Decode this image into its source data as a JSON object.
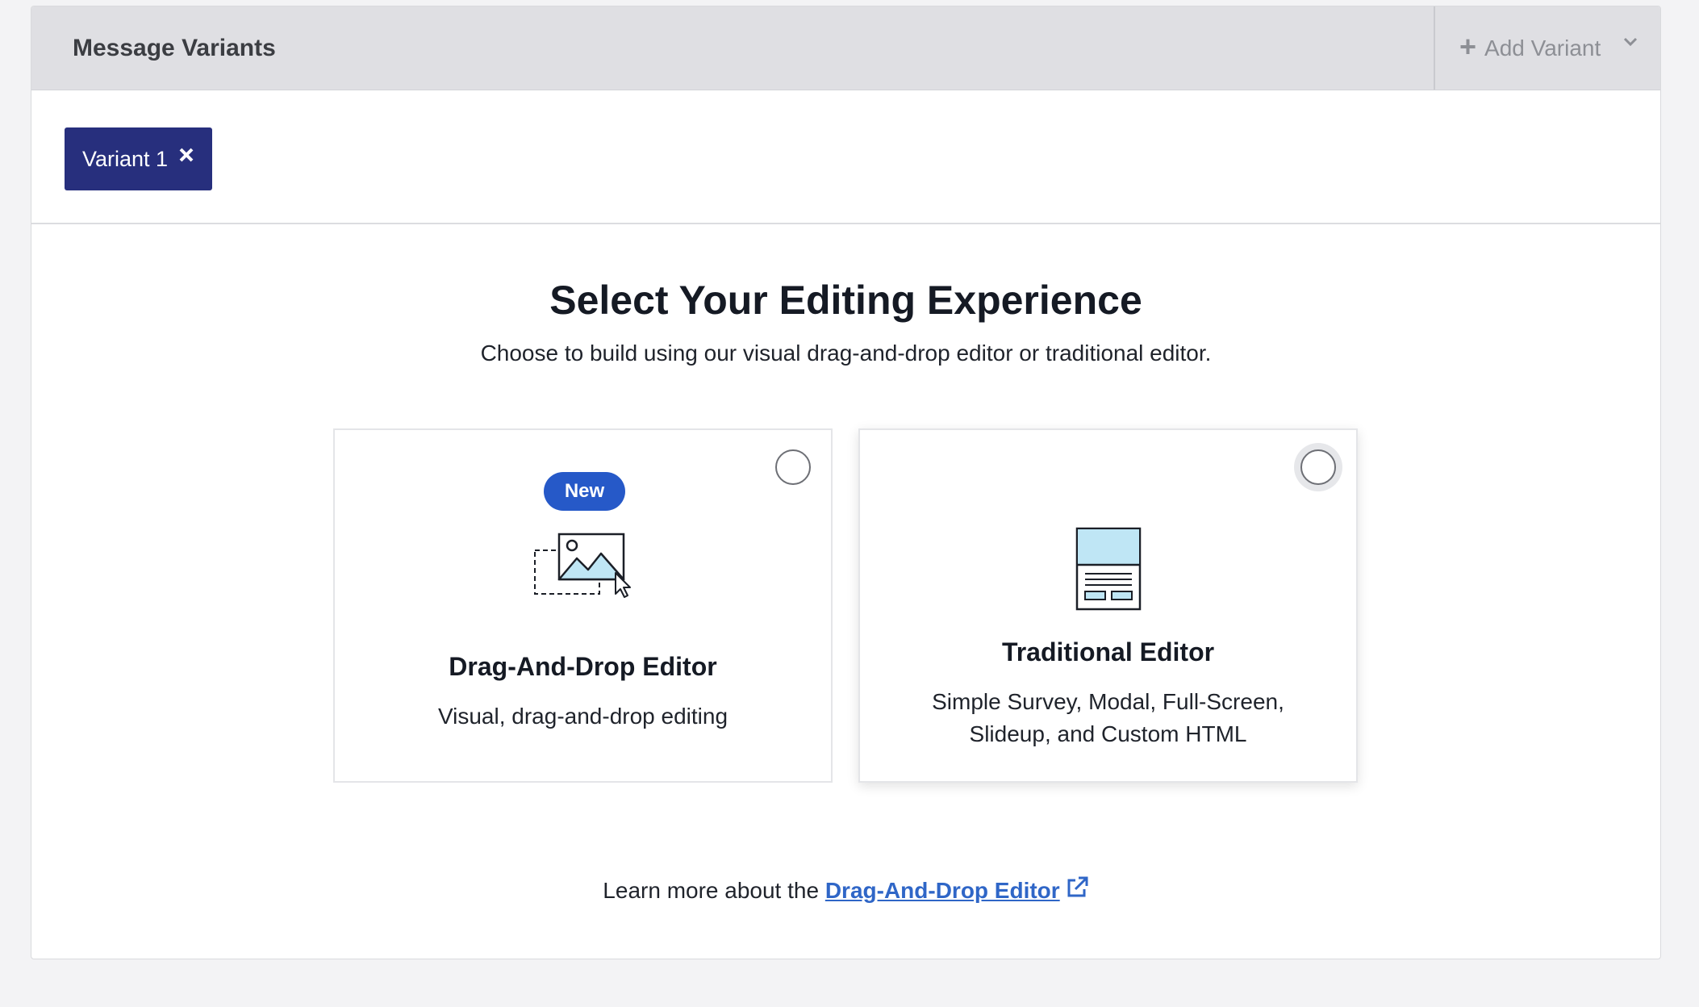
{
  "header": {
    "title": "Message Variants",
    "add_variant_label": "Add Variant"
  },
  "variants": [
    {
      "label": "Variant 1"
    }
  ],
  "main": {
    "heading": "Select Your Editing Experience",
    "subheading": "Choose to build using our visual drag-and-drop editor or traditional editor."
  },
  "cards": [
    {
      "badge": "New",
      "title": "Drag-And-Drop Editor",
      "description": "Visual, drag-and-drop editing",
      "icon": "drag-drop-image-icon"
    },
    {
      "title": "Traditional Editor",
      "description_line1": "Simple Survey, Modal, Full-Screen,",
      "description_line2": "Slideup, and Custom HTML",
      "icon": "document-layout-icon"
    }
  ],
  "footer": {
    "prefix": "Learn more about the",
    "link_label": "Drag-And-Drop Editor"
  },
  "colors": {
    "variant_tab": "#272f7d",
    "badge": "#2659c8",
    "link": "#2f66c7",
    "icon_fill": "#bfe6f5"
  }
}
